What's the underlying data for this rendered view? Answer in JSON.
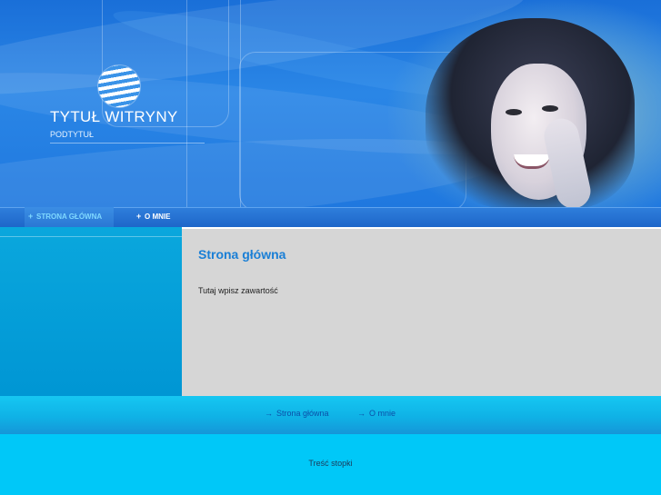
{
  "header": {
    "title": "TYTUŁ WITRYNY",
    "subtitle": "PODTYTUŁ",
    "logo_icon": "striped-globe-icon"
  },
  "nav": {
    "items": [
      {
        "label": "STRONA GŁÓWNA",
        "active": true
      },
      {
        "label": "O MNIE",
        "active": false
      }
    ],
    "bullet": "+"
  },
  "main": {
    "heading": "Strona główna",
    "body": "Tutaj wpisz zawartość"
  },
  "bottom_links": {
    "arrow": "→",
    "items": [
      {
        "label": "Strona główna"
      },
      {
        "label": "O mnie"
      }
    ]
  },
  "footer": {
    "text": "Treść stopki"
  },
  "colors": {
    "header_blue": "#1f78df",
    "nav_blue": "#1e66c9",
    "active_nav_text": "#7fd8ff",
    "sidebar_cyan": "#0096d4",
    "content_gray": "#d6d6d6",
    "heading_blue": "#1a7fd6",
    "footer_cyan": "#00c8f8"
  }
}
